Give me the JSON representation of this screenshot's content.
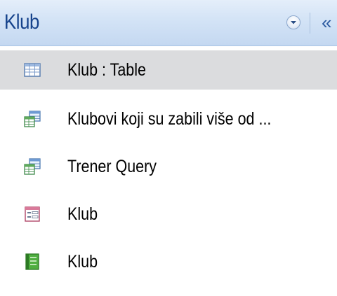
{
  "header": {
    "title": "Klub",
    "dropdown_icon": "chevron-down-circle-icon",
    "collapse_glyph": "«",
    "collapse_icon": "double-chevron-left-icon"
  },
  "items": [
    {
      "label": "Klub : Table",
      "icon": "table-icon",
      "selected": true
    },
    {
      "label": "Klubovi koji su zabili više od ...",
      "icon": "query-icon",
      "selected": false
    },
    {
      "label": "Trener Query",
      "icon": "query-icon",
      "selected": false
    },
    {
      "label": "Klub",
      "icon": "form-icon",
      "selected": false
    },
    {
      "label": "Klub",
      "icon": "report-icon",
      "selected": false
    }
  ],
  "colors": {
    "header_text": "#15428b",
    "selection": "#dbdcde"
  }
}
